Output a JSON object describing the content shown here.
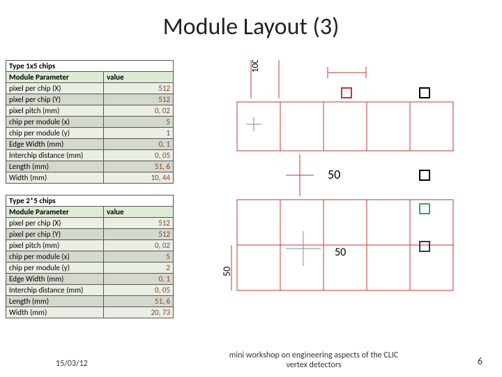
{
  "title": "Module Layout (3)",
  "tables": [
    {
      "header": "Type 1x5 chips",
      "col1": "Module Parameter",
      "col2": "value",
      "rows": [
        {
          "p": "pixel per chip (X)",
          "v": "512"
        },
        {
          "p": "pixel per chip (Y)",
          "v": "512"
        },
        {
          "p": "pixel pitch (mm)",
          "v": "0, 02"
        },
        {
          "p": "chip per module (x)",
          "v": "5"
        },
        {
          "p": "chip per module (y)",
          "v": "1"
        },
        {
          "p": "Edge Width (mm)",
          "v": "0, 1"
        },
        {
          "p": "Interchip distance (mm)",
          "v": "0, 05"
        },
        {
          "p": "Length (mm)",
          "v": "51, 6"
        },
        {
          "p": "Width (mm)",
          "v": "10, 44"
        }
      ]
    },
    {
      "header": "Type 2*5 chips",
      "col1": "Module Parameter",
      "col2": "value",
      "rows": [
        {
          "p": "pixel per chip (X)",
          "v": "512"
        },
        {
          "p": "pixel per chip (Y)",
          "v": "512"
        },
        {
          "p": "pixel pitch (mm)",
          "v": "0, 02"
        },
        {
          "p": "chip per module (x)",
          "v": "5"
        },
        {
          "p": "chip per module (y)",
          "v": "2"
        },
        {
          "p": "Edge Width (mm)",
          "v": "0, 1"
        },
        {
          "p": "Interchip distance (mm)",
          "v": "0, 05"
        },
        {
          "p": "Length (mm)",
          "v": "51, 6"
        },
        {
          "p": "Width (mm)",
          "v": "20, 73"
        }
      ]
    }
  ],
  "diagram": {
    "label100": "100",
    "label50a": "50",
    "label50b": "50",
    "label50c": "50"
  },
  "footer": {
    "date": "15/03/12",
    "text": "mini workshop on engineering aspects of the CLIC vertex detectors",
    "page": "6"
  }
}
